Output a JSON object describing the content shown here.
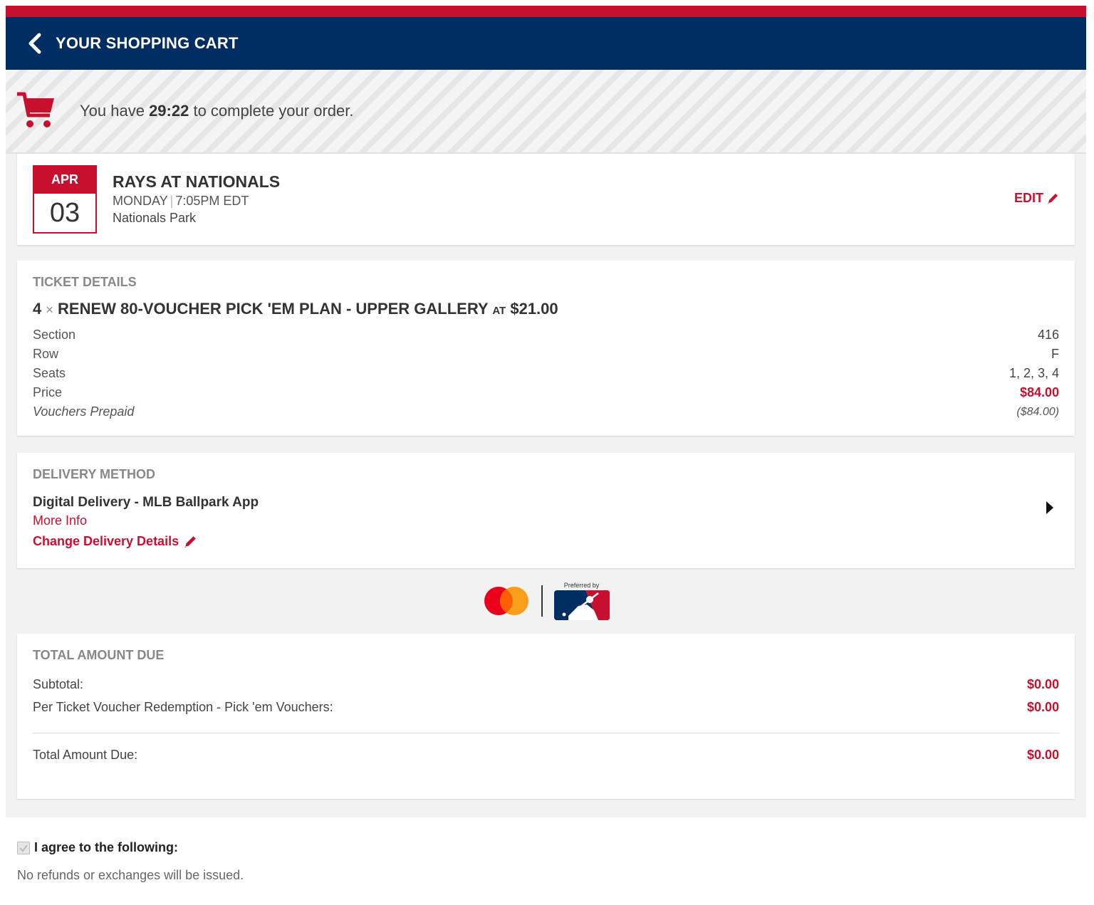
{
  "header": {
    "title": "YOUR SHOPPING CART",
    "back_icon": "chevron-left-icon"
  },
  "timer": {
    "prefix": "You have ",
    "time": "29:22",
    "suffix": " to complete your order.",
    "icon": "shopping-cart-icon"
  },
  "event": {
    "month": "APR",
    "day": "03",
    "title": "RAYS AT NATIONALS",
    "weekday": "MONDAY",
    "time": "7:05PM EDT",
    "venue": "Nationals Park",
    "edit_label": "EDIT"
  },
  "ticket": {
    "section_label": "TICKET DETAILS",
    "quantity": "4",
    "times": "×",
    "name": "RENEW 80-VOUCHER PICK 'EM PLAN - UPPER GALLERY",
    "at": "AT",
    "unit_price": "$21.00",
    "details": [
      {
        "label": "Section",
        "value": "416"
      },
      {
        "label": "Row",
        "value": "F"
      },
      {
        "label": "Seats",
        "value": "1, 2, 3, 4"
      },
      {
        "label": "Price",
        "value": "$84.00"
      },
      {
        "label": "Vouchers Prepaid",
        "value": "($84.00)"
      }
    ]
  },
  "delivery": {
    "section_label": "DELIVERY METHOD",
    "name": "Digital Delivery - MLB Ballpark App",
    "more_info": "More Info",
    "change_label": "Change Delivery Details"
  },
  "sponsor": {
    "preferred_text": "Preferred by"
  },
  "totals": {
    "section_label": "TOTAL AMOUNT DUE",
    "subtotal_label": "Subtotal:",
    "subtotal": "$0.00",
    "redemption_label": "Per Ticket Voucher Redemption - Pick 'em Vouchers:",
    "redemption": "$0.00",
    "total_label": "Total Amount Due:",
    "total": "$0.00"
  },
  "agreement": {
    "label": "I agree to the following:",
    "note": "No refunds or exchanges will be issued.",
    "checked": true
  },
  "colors": {
    "brand_red": "#c8102e",
    "brand_navy": "#002d62"
  }
}
